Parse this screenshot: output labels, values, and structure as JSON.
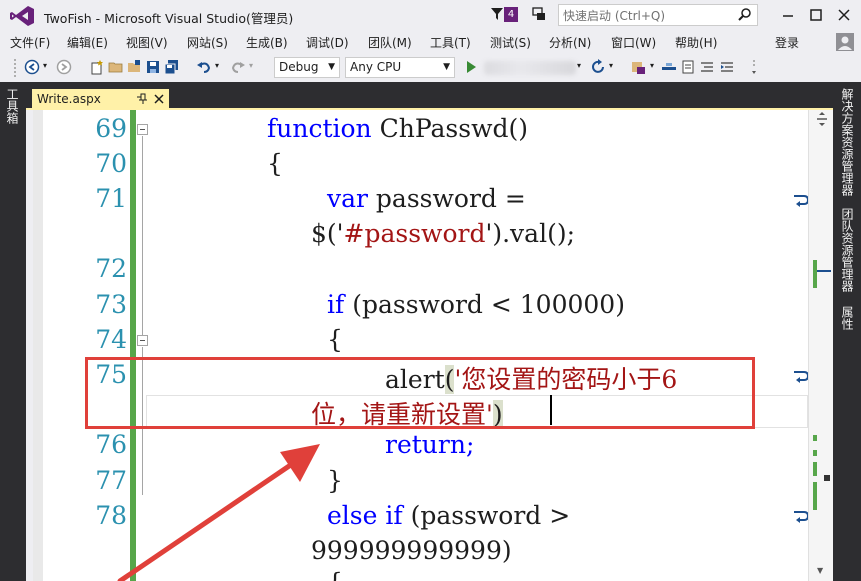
{
  "window": {
    "title": "TwoFish - Microsoft Visual Studio(管理员)",
    "notification_count": "4",
    "quick_launch_placeholder": "快速启动 (Ctrl+Q)"
  },
  "menu": {
    "items": [
      "文件(F)",
      "编辑(E)",
      "视图(V)",
      "网站(S)",
      "生成(B)",
      "调试(D)",
      "团队(M)",
      "工具(T)",
      "测试(S)",
      "分析(N)",
      "窗口(W)",
      "帮助(H)"
    ],
    "login": "登录"
  },
  "toolbar": {
    "configuration": "Debug",
    "platform": "Any CPU"
  },
  "side_tabs": {
    "left": "工具箱",
    "right": [
      "解决方案资源管理器",
      "团队资源管理器",
      "属性"
    ]
  },
  "document_tab": {
    "label": "Write.aspx"
  },
  "editor": {
    "line_numbers": [
      "69",
      "70",
      "71",
      "72",
      "73",
      "74",
      "75",
      "76",
      "77",
      "78"
    ],
    "code": {
      "l69_kw": "function",
      "l69_rest": " ChPasswd()",
      "l70": "{",
      "l71_kw": "var",
      "l71_rest": " password =",
      "l71b_pre": "$('",
      "l71b_str": "#password",
      "l71b_post": "').val();",
      "l73_kw": "if",
      "l73_rest": " (password < 100000)",
      "l74": "{",
      "l75_call": "alert",
      "l75_str1": "'您设置的密码小于6",
      "l75b_str2": "位，请重新设置'",
      "l76": "return;",
      "l77": "}",
      "l78_kw": "else if",
      "l78_rest": " (password >",
      "l78b": "999999999999)",
      "l79": "{"
    }
  },
  "colors": {
    "chrome": "#2d2d30",
    "tab_active": "#fff1a8",
    "keyword": "#0000ff",
    "string": "#a31515",
    "line_number": "#2b91af",
    "change_bar": "#57a64a",
    "annotation": "#e0403a"
  }
}
